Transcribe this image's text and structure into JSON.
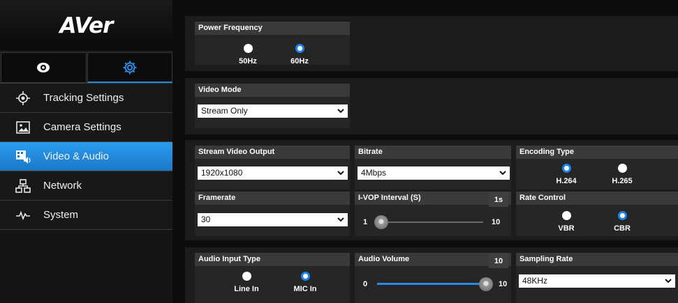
{
  "brand": {
    "logo_text": "AVer"
  },
  "mode_tabs": [
    {
      "icon": "eye-icon",
      "active": false
    },
    {
      "icon": "gear-icon",
      "active": true
    }
  ],
  "sidebar": {
    "items": [
      {
        "label": "Tracking Settings",
        "icon": "target-icon",
        "active": false
      },
      {
        "label": "Camera Settings",
        "icon": "image-icon",
        "active": false
      },
      {
        "label": "Video & Audio",
        "icon": "video-audio-icon",
        "active": true
      },
      {
        "label": "Network",
        "icon": "network-icon",
        "active": false
      },
      {
        "label": "System",
        "icon": "pulse-icon",
        "active": false
      }
    ]
  },
  "power_frequency": {
    "title": "Power Frequency",
    "options": [
      {
        "label": "50Hz",
        "selected": false
      },
      {
        "label": "60Hz",
        "selected": true
      }
    ]
  },
  "video_mode": {
    "title": "Video Mode",
    "value": "Stream Only"
  },
  "stream_video_output": {
    "title": "Stream Video Output",
    "value": "1920x1080"
  },
  "bitrate": {
    "title": "Bitrate",
    "value": "4Mbps"
  },
  "encoding_type": {
    "title": "Encoding Type",
    "options": [
      {
        "label": "H.264",
        "selected": true
      },
      {
        "label": "H.265",
        "selected": false
      }
    ]
  },
  "framerate": {
    "title": "Framerate",
    "value": "30"
  },
  "ivop_interval": {
    "title": "I-VOP Interval (S)",
    "badge": "1s",
    "min": "1",
    "max": "10",
    "value": 1
  },
  "rate_control": {
    "title": "Rate Control",
    "options": [
      {
        "label": "VBR",
        "selected": false
      },
      {
        "label": "CBR",
        "selected": true
      }
    ]
  },
  "audio_input_type": {
    "title": "Audio Input Type",
    "options": [
      {
        "label": "Line In",
        "selected": false
      },
      {
        "label": "MIC In",
        "selected": true
      }
    ]
  },
  "audio_volume": {
    "title": "Audio Volume",
    "badge": "10",
    "min": "0",
    "max": "10",
    "value": 10
  },
  "sampling_rate": {
    "title": "Sampling Rate",
    "value": "48KHz"
  },
  "colors": {
    "accent": "#1a84e8",
    "active_nav": "#2090e0",
    "panel": "#262626",
    "header": "#3a3a3a"
  }
}
